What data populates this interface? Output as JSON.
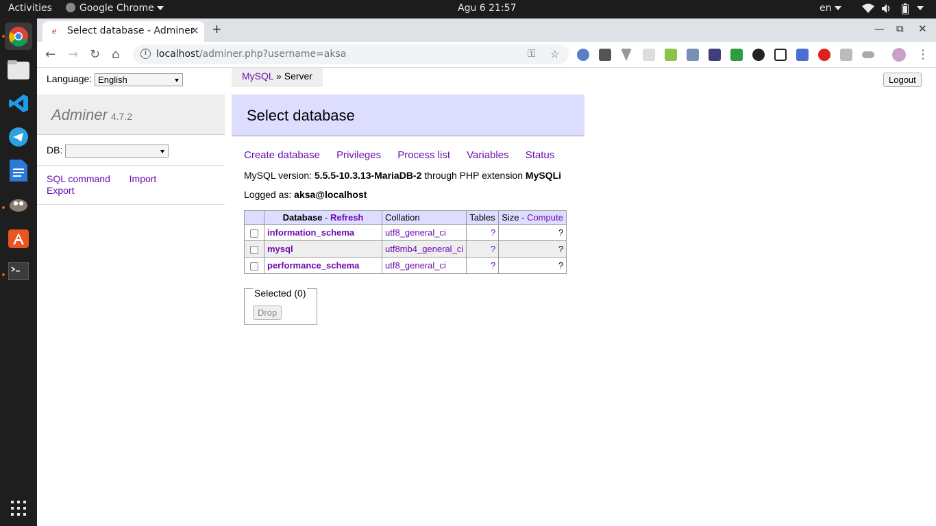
{
  "topbar": {
    "activities": "Activities",
    "app": "Google Chrome",
    "datetime": "Agu 6  21:57",
    "lang": "en"
  },
  "browser": {
    "tab_title": "Select database - Adminer",
    "url_host": "localhost",
    "url_path": "/adminer.php?username=aksa"
  },
  "sidebar": {
    "language_label": "Language:",
    "language_value": "English",
    "app_name": "Adminer",
    "app_version": "4.7.2",
    "db_label": "DB:",
    "links": {
      "sql_command": "SQL command",
      "import": "Import",
      "export": "Export"
    }
  },
  "breadcrumb": {
    "root": "MySQL",
    "sep": " » ",
    "current": "Server"
  },
  "logout_label": "Logout",
  "heading": "Select database",
  "nav_links": [
    "Create database",
    "Privileges",
    "Process list",
    "Variables",
    "Status"
  ],
  "version": {
    "prefix": "MySQL version: ",
    "value": "5.5.5-10.3.13-MariaDB-2",
    "mid": " through PHP extension ",
    "ext": "MySQLi"
  },
  "logged": {
    "prefix": "Logged as: ",
    "user": "aksa@localhost"
  },
  "table": {
    "headers": {
      "database": "Database",
      "sep": " - ",
      "refresh": "Refresh",
      "collation": "Collation",
      "tables": "Tables",
      "size": "Size",
      "compute": "Compute"
    },
    "rows": [
      {
        "name": "information_schema",
        "collation": "utf8_general_ci",
        "tables": "?",
        "size": "?"
      },
      {
        "name": "mysql",
        "collation": "utf8mb4_general_ci",
        "tables": "?",
        "size": "?"
      },
      {
        "name": "performance_schema",
        "collation": "utf8_general_ci",
        "tables": "?",
        "size": "?"
      }
    ]
  },
  "selected": {
    "legend": "Selected (0)",
    "drop": "Drop"
  }
}
